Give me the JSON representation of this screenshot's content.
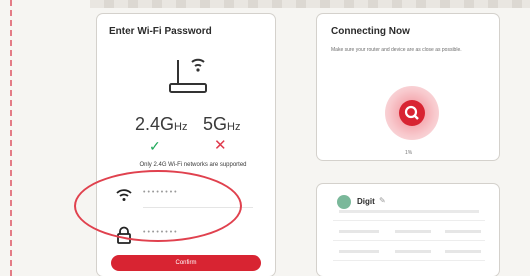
{
  "left_screen": {
    "title": "Enter Wi-Fi Password",
    "band_24": "2.4G",
    "band_24_unit": "Hz",
    "band_5": "5G",
    "band_5_unit": "Hz",
    "support_text": "Only 2.4G Wi-Fi networks are supported",
    "wifi_value": "••••••••",
    "password_value": "••••••••",
    "confirm_label": "Confirm"
  },
  "connecting": {
    "title": "Connecting Now",
    "description": "Make sure your router and device are as close as possible.",
    "progress": "1%"
  },
  "device": {
    "name": "Digit"
  },
  "colors": {
    "accent": "#d82432",
    "check": "#1fa95a",
    "highlight": "#e0414e"
  }
}
